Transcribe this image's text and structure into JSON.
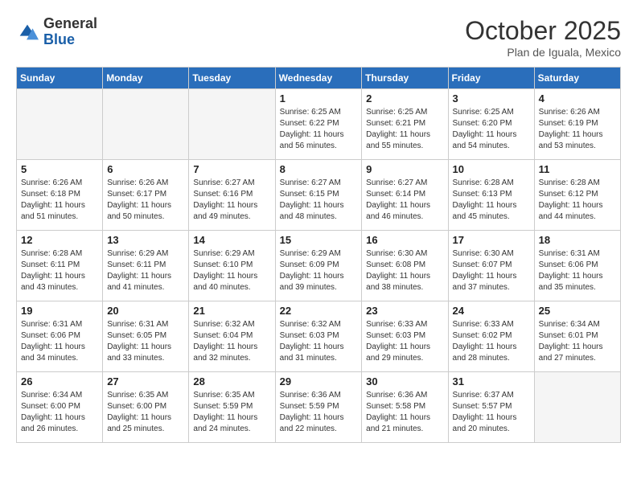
{
  "header": {
    "logo_general": "General",
    "logo_blue": "Blue",
    "month_title": "October 2025",
    "subtitle": "Plan de Iguala, Mexico"
  },
  "weekdays": [
    "Sunday",
    "Monday",
    "Tuesday",
    "Wednesday",
    "Thursday",
    "Friday",
    "Saturday"
  ],
  "weeks": [
    [
      {
        "day": "",
        "empty": true
      },
      {
        "day": "",
        "empty": true
      },
      {
        "day": "",
        "empty": true
      },
      {
        "day": "1",
        "sunrise": "Sunrise: 6:25 AM",
        "sunset": "Sunset: 6:22 PM",
        "daylight": "Daylight: 11 hours and 56 minutes."
      },
      {
        "day": "2",
        "sunrise": "Sunrise: 6:25 AM",
        "sunset": "Sunset: 6:21 PM",
        "daylight": "Daylight: 11 hours and 55 minutes."
      },
      {
        "day": "3",
        "sunrise": "Sunrise: 6:25 AM",
        "sunset": "Sunset: 6:20 PM",
        "daylight": "Daylight: 11 hours and 54 minutes."
      },
      {
        "day": "4",
        "sunrise": "Sunrise: 6:26 AM",
        "sunset": "Sunset: 6:19 PM",
        "daylight": "Daylight: 11 hours and 53 minutes."
      }
    ],
    [
      {
        "day": "5",
        "sunrise": "Sunrise: 6:26 AM",
        "sunset": "Sunset: 6:18 PM",
        "daylight": "Daylight: 11 hours and 51 minutes."
      },
      {
        "day": "6",
        "sunrise": "Sunrise: 6:26 AM",
        "sunset": "Sunset: 6:17 PM",
        "daylight": "Daylight: 11 hours and 50 minutes."
      },
      {
        "day": "7",
        "sunrise": "Sunrise: 6:27 AM",
        "sunset": "Sunset: 6:16 PM",
        "daylight": "Daylight: 11 hours and 49 minutes."
      },
      {
        "day": "8",
        "sunrise": "Sunrise: 6:27 AM",
        "sunset": "Sunset: 6:15 PM",
        "daylight": "Daylight: 11 hours and 48 minutes."
      },
      {
        "day": "9",
        "sunrise": "Sunrise: 6:27 AM",
        "sunset": "Sunset: 6:14 PM",
        "daylight": "Daylight: 11 hours and 46 minutes."
      },
      {
        "day": "10",
        "sunrise": "Sunrise: 6:28 AM",
        "sunset": "Sunset: 6:13 PM",
        "daylight": "Daylight: 11 hours and 45 minutes."
      },
      {
        "day": "11",
        "sunrise": "Sunrise: 6:28 AM",
        "sunset": "Sunset: 6:12 PM",
        "daylight": "Daylight: 11 hours and 44 minutes."
      }
    ],
    [
      {
        "day": "12",
        "sunrise": "Sunrise: 6:28 AM",
        "sunset": "Sunset: 6:11 PM",
        "daylight": "Daylight: 11 hours and 43 minutes."
      },
      {
        "day": "13",
        "sunrise": "Sunrise: 6:29 AM",
        "sunset": "Sunset: 6:11 PM",
        "daylight": "Daylight: 11 hours and 41 minutes."
      },
      {
        "day": "14",
        "sunrise": "Sunrise: 6:29 AM",
        "sunset": "Sunset: 6:10 PM",
        "daylight": "Daylight: 11 hours and 40 minutes."
      },
      {
        "day": "15",
        "sunrise": "Sunrise: 6:29 AM",
        "sunset": "Sunset: 6:09 PM",
        "daylight": "Daylight: 11 hours and 39 minutes."
      },
      {
        "day": "16",
        "sunrise": "Sunrise: 6:30 AM",
        "sunset": "Sunset: 6:08 PM",
        "daylight": "Daylight: 11 hours and 38 minutes."
      },
      {
        "day": "17",
        "sunrise": "Sunrise: 6:30 AM",
        "sunset": "Sunset: 6:07 PM",
        "daylight": "Daylight: 11 hours and 37 minutes."
      },
      {
        "day": "18",
        "sunrise": "Sunrise: 6:31 AM",
        "sunset": "Sunset: 6:06 PM",
        "daylight": "Daylight: 11 hours and 35 minutes."
      }
    ],
    [
      {
        "day": "19",
        "sunrise": "Sunrise: 6:31 AM",
        "sunset": "Sunset: 6:06 PM",
        "daylight": "Daylight: 11 hours and 34 minutes."
      },
      {
        "day": "20",
        "sunrise": "Sunrise: 6:31 AM",
        "sunset": "Sunset: 6:05 PM",
        "daylight": "Daylight: 11 hours and 33 minutes."
      },
      {
        "day": "21",
        "sunrise": "Sunrise: 6:32 AM",
        "sunset": "Sunset: 6:04 PM",
        "daylight": "Daylight: 11 hours and 32 minutes."
      },
      {
        "day": "22",
        "sunrise": "Sunrise: 6:32 AM",
        "sunset": "Sunset: 6:03 PM",
        "daylight": "Daylight: 11 hours and 31 minutes."
      },
      {
        "day": "23",
        "sunrise": "Sunrise: 6:33 AM",
        "sunset": "Sunset: 6:03 PM",
        "daylight": "Daylight: 11 hours and 29 minutes."
      },
      {
        "day": "24",
        "sunrise": "Sunrise: 6:33 AM",
        "sunset": "Sunset: 6:02 PM",
        "daylight": "Daylight: 11 hours and 28 minutes."
      },
      {
        "day": "25",
        "sunrise": "Sunrise: 6:34 AM",
        "sunset": "Sunset: 6:01 PM",
        "daylight": "Daylight: 11 hours and 27 minutes."
      }
    ],
    [
      {
        "day": "26",
        "sunrise": "Sunrise: 6:34 AM",
        "sunset": "Sunset: 6:00 PM",
        "daylight": "Daylight: 11 hours and 26 minutes."
      },
      {
        "day": "27",
        "sunrise": "Sunrise: 6:35 AM",
        "sunset": "Sunset: 6:00 PM",
        "daylight": "Daylight: 11 hours and 25 minutes."
      },
      {
        "day": "28",
        "sunrise": "Sunrise: 6:35 AM",
        "sunset": "Sunset: 5:59 PM",
        "daylight": "Daylight: 11 hours and 24 minutes."
      },
      {
        "day": "29",
        "sunrise": "Sunrise: 6:36 AM",
        "sunset": "Sunset: 5:59 PM",
        "daylight": "Daylight: 11 hours and 22 minutes."
      },
      {
        "day": "30",
        "sunrise": "Sunrise: 6:36 AM",
        "sunset": "Sunset: 5:58 PM",
        "daylight": "Daylight: 11 hours and 21 minutes."
      },
      {
        "day": "31",
        "sunrise": "Sunrise: 6:37 AM",
        "sunset": "Sunset: 5:57 PM",
        "daylight": "Daylight: 11 hours and 20 minutes."
      },
      {
        "day": "",
        "empty": true
      }
    ]
  ]
}
